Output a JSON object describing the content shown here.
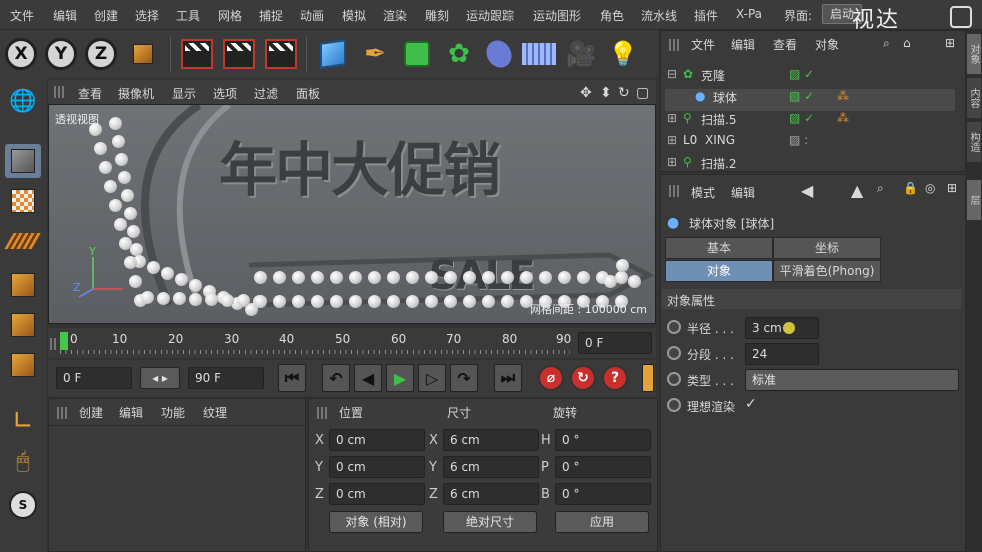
{
  "menu": [
    "文件",
    "编辑",
    "创建",
    "选择",
    "工具",
    "网格",
    "捕捉",
    "动画",
    "模拟",
    "渲染",
    "雕刻",
    "运动跟踪",
    "运动图形",
    "角色",
    "流水线",
    "插件",
    "X-Pa",
    "界面:"
  ],
  "layout_button": "启动",
  "watermark": "视达",
  "top_toolbar": {
    "x": "X",
    "y": "Y",
    "z": "Z"
  },
  "viewport_menu": [
    "查看",
    "摄像机",
    "显示",
    "选项",
    "过滤",
    "面板"
  ],
  "viewport": {
    "label": "透视视图",
    "grid_spacing": "网格间距 : 100000 cm",
    "headline": "年中大促销",
    "sale": "SALE",
    "axis_y": "Y",
    "axis_z": "Z"
  },
  "timeline": {
    "ticks": [
      "0",
      "10",
      "20",
      "30",
      "40",
      "50",
      "60",
      "70",
      "80",
      "90"
    ],
    "current_frame": "0 F"
  },
  "transport": {
    "start": "0 F",
    "end": "90 F"
  },
  "material_menu": [
    "创建",
    "编辑",
    "功能",
    "纹理"
  ],
  "coord": {
    "headers": [
      "位置",
      "尺寸",
      "旋转"
    ],
    "rows": [
      {
        "a": "X",
        "av": "0 cm",
        "b": "X",
        "bv": "6 cm",
        "c": "H",
        "cv": "0 °"
      },
      {
        "a": "Y",
        "av": "0 cm",
        "b": "Y",
        "bv": "6 cm",
        "c": "P",
        "cv": "0 °"
      },
      {
        "a": "Z",
        "av": "0 cm",
        "b": "Z",
        "bv": "6 cm",
        "c": "B",
        "cv": "0 °"
      }
    ],
    "mode": "对象 (相对)",
    "size_mode": "绝对尺寸",
    "apply": "应用"
  },
  "object_manager": {
    "menu": [
      "文件",
      "编辑",
      "查看",
      "对象"
    ],
    "objects": [
      {
        "name": "克隆",
        "color": "#e39a2b"
      },
      {
        "name": "球体",
        "color": "#e39a2b"
      },
      {
        "name": "扫描.5",
        "color": "#d8d8d8"
      },
      {
        "name": "XING",
        "color": "#d8d8d8"
      },
      {
        "name": "扫描.2",
        "color": "#d8d8d8"
      }
    ]
  },
  "attributes": {
    "menu": [
      "模式",
      "编辑"
    ],
    "title": "球体对象 [球体]",
    "tabs": [
      "基本",
      "坐标",
      "对象",
      "平滑着色(Phong)"
    ],
    "section": "对象属性",
    "props": [
      {
        "label": "半径 . . .",
        "value": "3 cm"
      },
      {
        "label": "分段 . . .",
        "value": "24"
      },
      {
        "label": "类型 . . .",
        "value": "标准"
      },
      {
        "label": "理想渲染",
        "value": "✓"
      }
    ]
  },
  "right_tabs": [
    "对象",
    "内容",
    "构造",
    "层"
  ]
}
